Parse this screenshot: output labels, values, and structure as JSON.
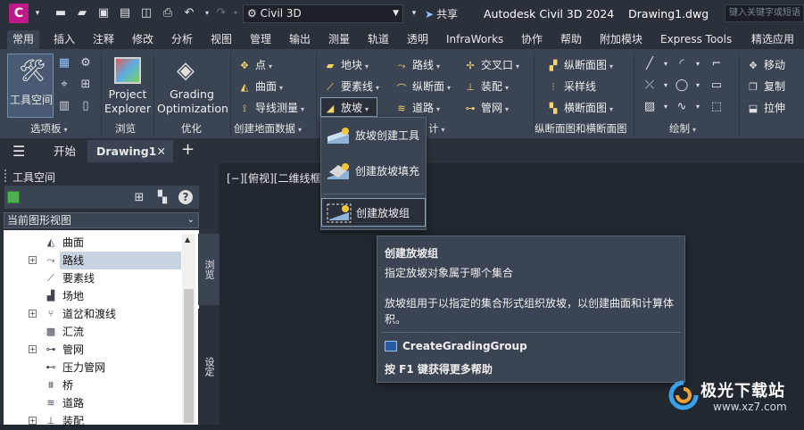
{
  "titlebar": {
    "app_letter": "C",
    "workspace": "Civil 3D",
    "share_label": "共享",
    "title": "Autodesk Civil 3D 2024    Drawing1.dwg",
    "search_placeholder": "键入关键字或短语"
  },
  "ribbon_tabs": [
    "常用",
    "插入",
    "注释",
    "修改",
    "分析",
    "视图",
    "管理",
    "输出",
    "测量",
    "轨道",
    "透明",
    "InfraWorks",
    "协作",
    "帮助",
    "附加模块",
    "Express Tools",
    "精选应用"
  ],
  "ribbon": {
    "toolspace_label": "工具空间",
    "panel_palettes": "选项板",
    "project_explorer_1": "Project",
    "project_explorer_2": "Explorer",
    "panel_browse": "浏览",
    "grading_opt_1": "Grading",
    "grading_opt_2": "Optimization",
    "panel_optimize": "优化",
    "ground": [
      "点",
      "曲面",
      "导线测量"
    ],
    "panel_ground": "创建地面数据",
    "design_col1": [
      "地块",
      "要素线",
      "放坡"
    ],
    "design_col2": [
      "路线",
      "纵断面",
      "道路"
    ],
    "design_col3": [
      "交叉口",
      "装配",
      "管网"
    ],
    "panel_design_suffix": "计",
    "profile": [
      "纵断面图",
      "采样线",
      "横断面图"
    ],
    "panel_profile": "纵断面图和横断面图",
    "panel_draw": "绘制",
    "modify": [
      "移动",
      "复制",
      "拉伸"
    ]
  },
  "doc_tabs": {
    "start": "开始",
    "drawing": "Drawing1"
  },
  "toolspace": {
    "title": "工具空间",
    "view_select": "当前图形视图",
    "tree": [
      {
        "label": "曲面",
        "expander": false,
        "icon": "surface-icon"
      },
      {
        "label": "路线",
        "expander": true,
        "icon": "alignment-icon",
        "selected": true
      },
      {
        "label": "要素线",
        "expander": false,
        "icon": "featureline-icon"
      },
      {
        "label": "场地",
        "expander": false,
        "icon": "site-icon"
      },
      {
        "label": "道岔和渡线",
        "expander": true,
        "icon": "turnout-icon"
      },
      {
        "label": "汇流",
        "expander": false,
        "icon": "catchment-icon"
      },
      {
        "label": "管网",
        "expander": true,
        "icon": "pipe-icon"
      },
      {
        "label": "压力管网",
        "expander": false,
        "icon": "pressure-pipe-icon"
      },
      {
        "label": "桥",
        "expander": false,
        "icon": "bridge-icon"
      },
      {
        "label": "道路",
        "expander": false,
        "icon": "corridor-icon"
      },
      {
        "label": "装配",
        "expander": true,
        "icon": "assembly-icon"
      }
    ],
    "side_tab_browse": "浏览",
    "side_tab_settings": "设定"
  },
  "viewport_label": "[−][俯视][二维线框",
  "dropdown": {
    "items": [
      "放坡创建工具",
      "创建放坡填充",
      "创建放坡组"
    ]
  },
  "tooltip": {
    "title": "创建放坡组",
    "subtitle": "指定放坡对象属于哪个集合",
    "desc_line1": "放坡组用于以指定的集合形式组织放坡，以创建曲面和计算体",
    "desc_line2": "积。",
    "command": "CreateGradingGroup",
    "help": "按 F1 键获得更多帮助"
  },
  "watermark": {
    "text": "极光下载站",
    "url": "www.xz7.com"
  },
  "colors": {
    "app_logo": "#c2188a",
    "ribbon_bg": "#3b4453",
    "title_bg": "#2b313a",
    "canvas_bg": "#212830"
  }
}
